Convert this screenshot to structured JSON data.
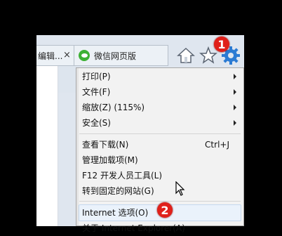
{
  "tabs": {
    "left_label": "编辑...",
    "right_label": "微信网页版",
    "close_glyph": "×"
  },
  "menu": {
    "items": [
      {
        "label": "打印(P)"
      },
      {
        "label": "文件(F)"
      },
      {
        "label": "缩放(Z) (115%)"
      },
      {
        "label": "安全(S)"
      },
      {
        "label": "查看下载(N)",
        "shortcut": "Ctrl+J"
      },
      {
        "label": "管理加载项(M)"
      },
      {
        "label": "F12 开发人员工具(L)"
      },
      {
        "label": "转到固定的网站(G)"
      },
      {
        "label": "Internet 选项(O)"
      },
      {
        "label": "关于 Internet Explorer(A)"
      }
    ]
  },
  "annotations": {
    "badge1": "1",
    "badge2": "2"
  },
  "colors": {
    "accent_gear": "#2b7bd3",
    "badge": "#e0201a",
    "menu_bg": "#f2f2f2"
  }
}
